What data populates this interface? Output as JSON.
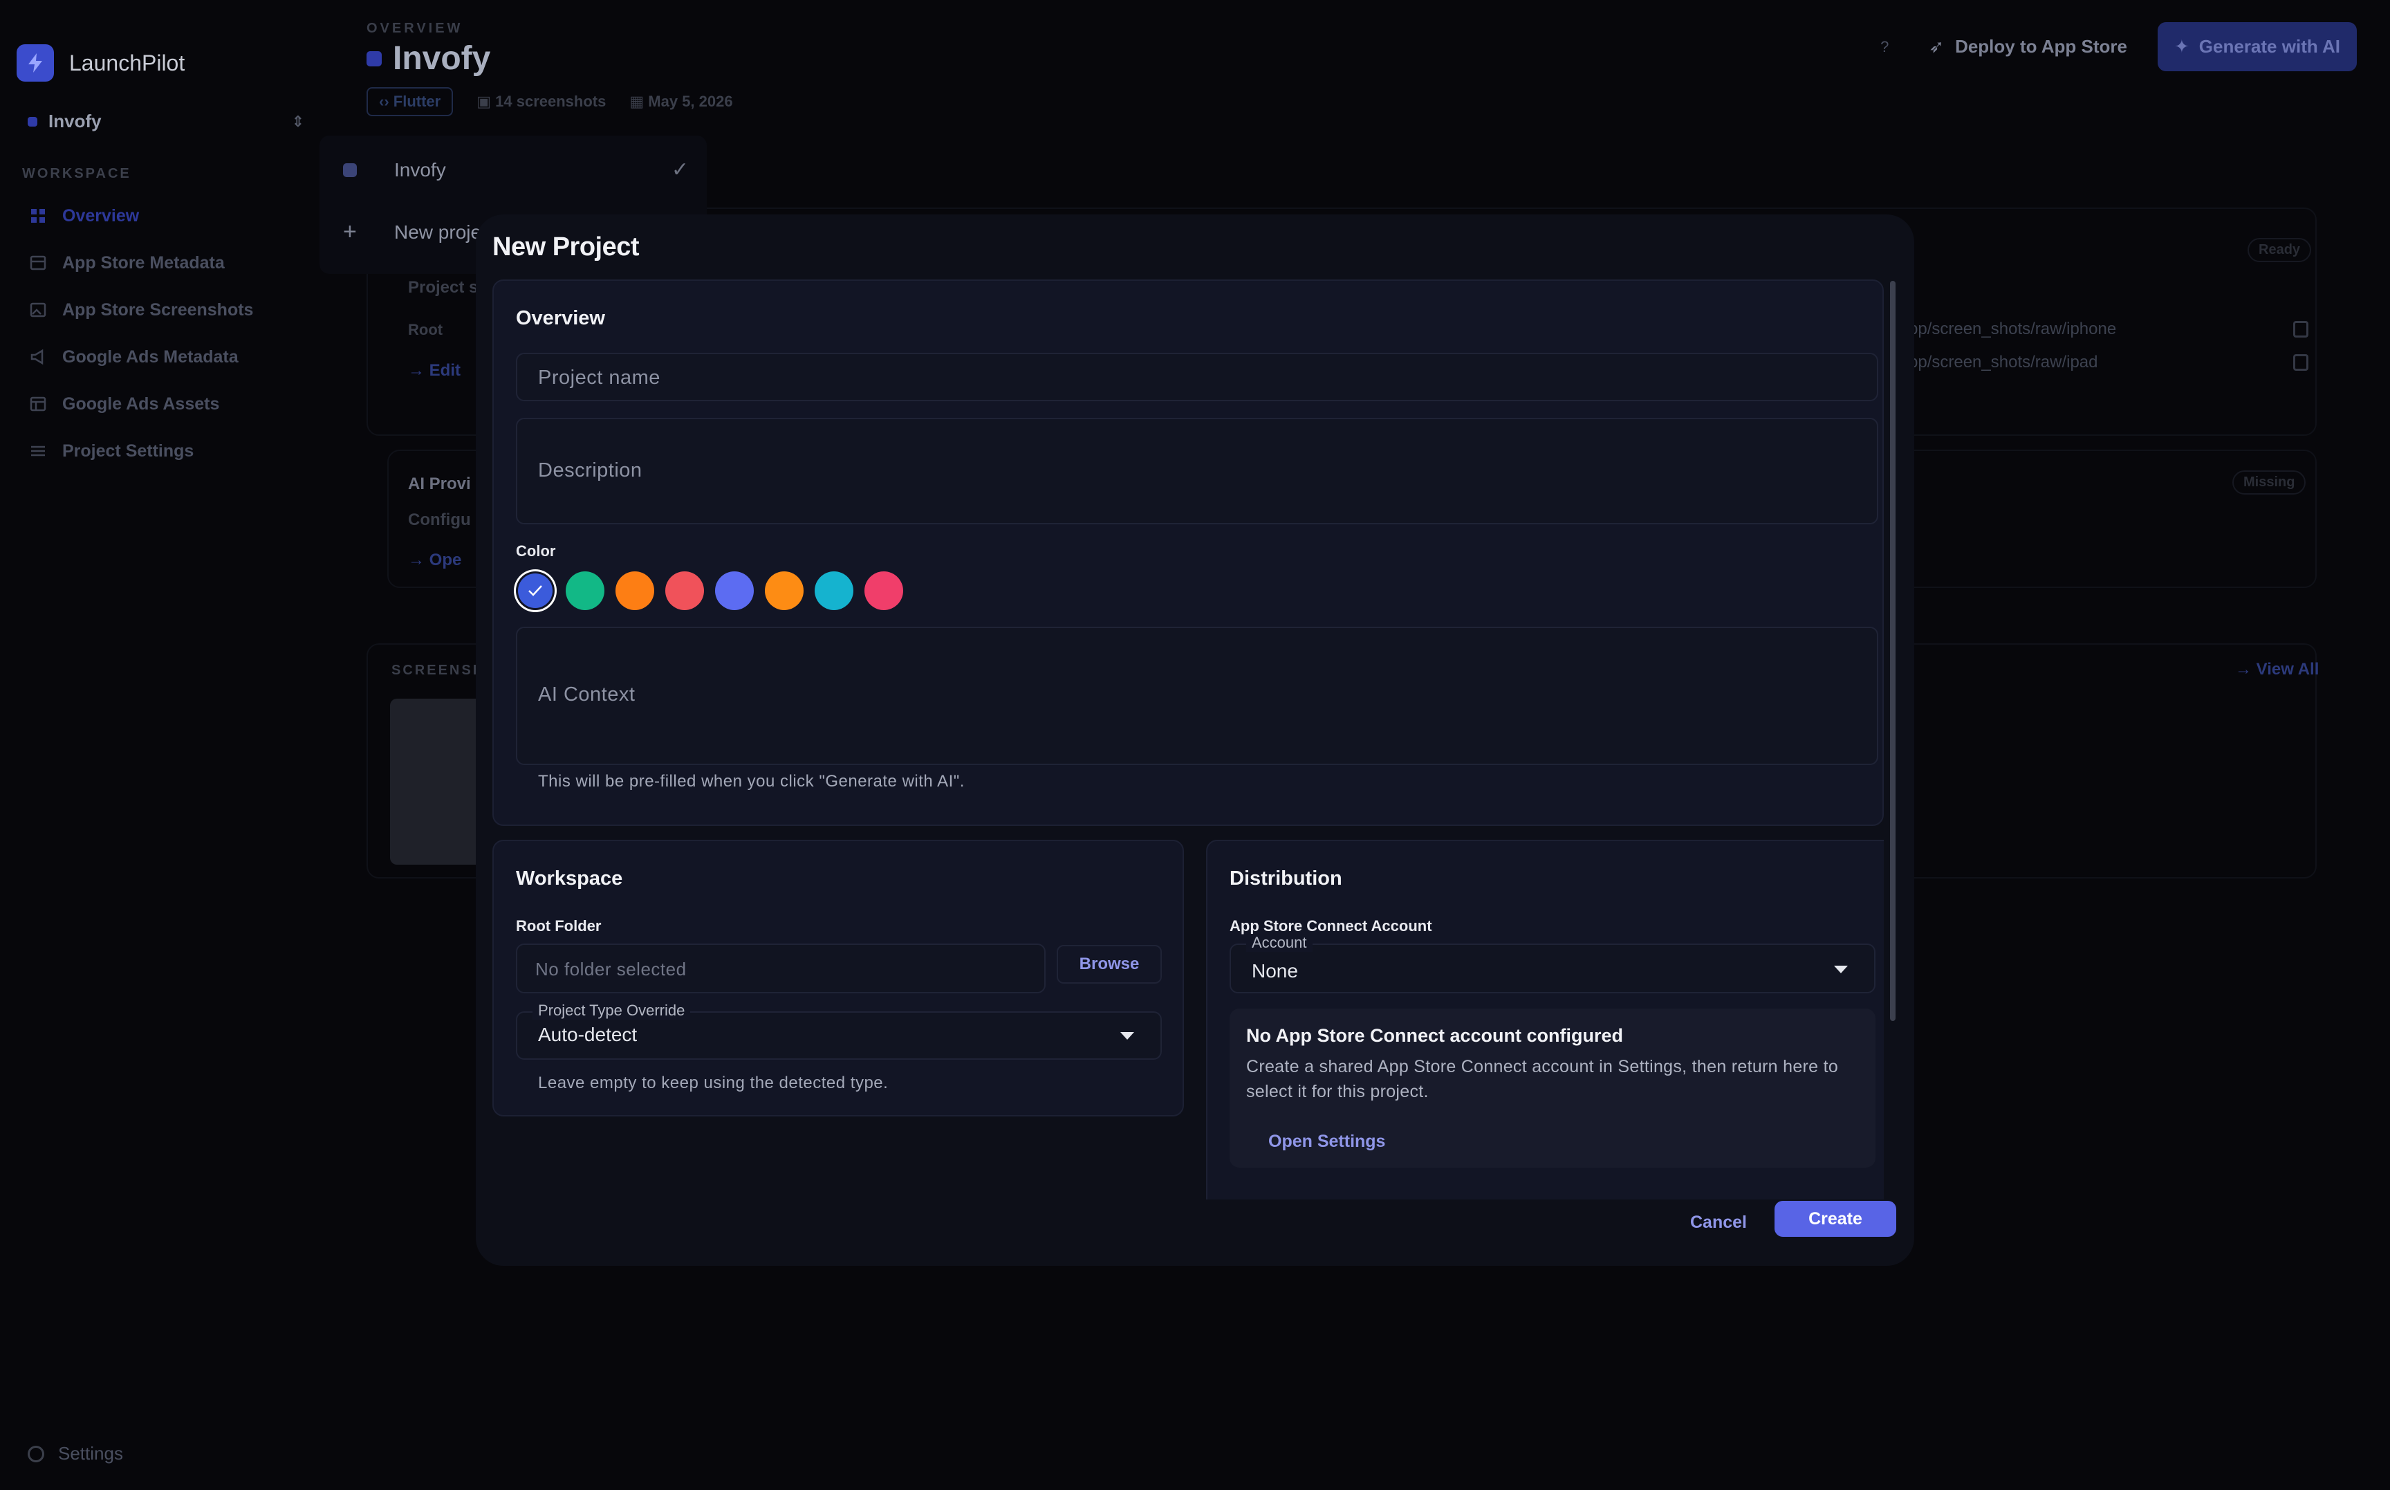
{
  "app": {
    "name": "LaunchPilot"
  },
  "sidebar": {
    "project": "Invofy",
    "section_label": "WORKSPACE",
    "items": [
      {
        "label": "Overview",
        "icon": "grid-icon",
        "active": true
      },
      {
        "label": "App Store Metadata",
        "icon": "archive-icon"
      },
      {
        "label": "App Store Screenshots",
        "icon": "image-icon"
      },
      {
        "label": "Google Ads Metadata",
        "icon": "megaphone-icon"
      },
      {
        "label": "Google Ads Assets",
        "icon": "table-icon"
      },
      {
        "label": "Project Settings",
        "icon": "sliders-icon"
      }
    ],
    "settings": "Settings"
  },
  "header": {
    "eyebrow": "OVERVIEW",
    "title": "Invofy",
    "tag": "Flutter",
    "screenshots": "14 screenshots",
    "date": "May 5, 2026",
    "help": "?",
    "deploy": "Deploy to App Store",
    "generate": "Generate with AI"
  },
  "background": {
    "project_text": "Project s",
    "root_label": "Root",
    "edit_link": "Edit",
    "ai_title": "AI Provi",
    "ai_text": "Configu",
    "open_link": "Ope",
    "screens_label": "SCREENSH",
    "ready_badge": "Ready",
    "missing_badge": "Missing",
    "path_iphone": "pp/screen_shots/raw/iphone",
    "path_ipad": "pp/screen_shots/raw/ipad",
    "view_all": "View All"
  },
  "dropdown": {
    "items": [
      {
        "label": "Invofy",
        "selected": true
      },
      {
        "label": "New proje"
      }
    ]
  },
  "modal": {
    "title": "New Project",
    "overview": {
      "title": "Overview",
      "name_placeholder": "Project name",
      "description_placeholder": "Description",
      "color_label": "Color",
      "colors": [
        "#3b5bdb",
        "#12b886",
        "#fd7e14",
        "#f0525a",
        "#5c6cf2",
        "#fd8c14",
        "#15b3cf",
        "#f03e6a"
      ],
      "selected_color_index": 0,
      "ai_context_placeholder": "AI Context",
      "ai_helper": "This will be pre-filled when you click \"Generate with AI\"."
    },
    "workspace": {
      "title": "Workspace",
      "root_label": "Root Folder",
      "folder_placeholder": "No folder selected",
      "browse": "Browse",
      "type_label": "Project Type Override",
      "type_value": "Auto-detect",
      "helper": "Leave empty to keep using the detected type."
    },
    "distribution": {
      "title": "Distribution",
      "account_section": "App Store Connect Account",
      "account_label": "Account",
      "account_value": "None",
      "notice_title": "No App Store Connect account configured",
      "notice_body": "Create a shared App Store Connect account in Settings, then return here to select it for this project.",
      "open_settings": "Open Settings"
    },
    "cancel": "Cancel",
    "create": "Create"
  }
}
